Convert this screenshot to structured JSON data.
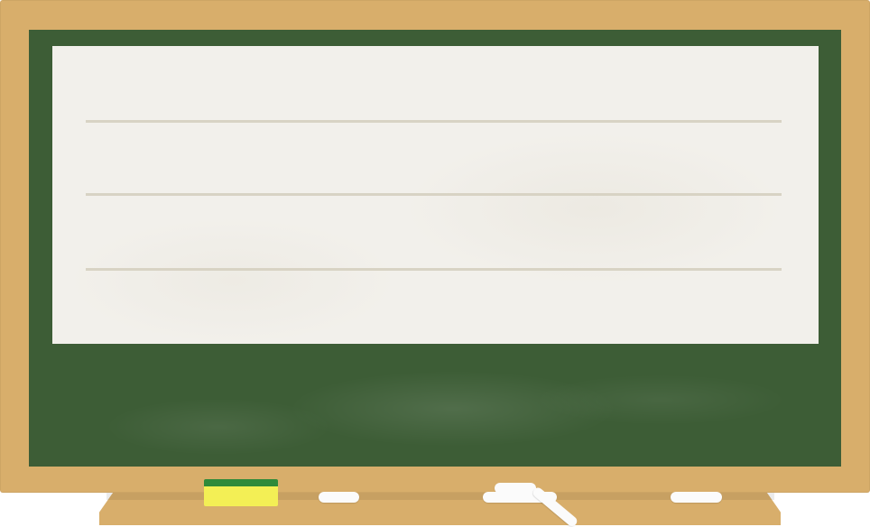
{
  "scene": {
    "description_label": "",
    "colors": {
      "frame": "#d8ae6b",
      "board": "#3d5d36",
      "paper": "#f2f0eb",
      "rule_line": "#d8d3c4",
      "eraser_top": "#2f8a3a",
      "eraser_body": "#f3ef55",
      "chalk": "#fbfbfb"
    },
    "icons": [
      "eraser-icon",
      "chalk-icon"
    ]
  }
}
